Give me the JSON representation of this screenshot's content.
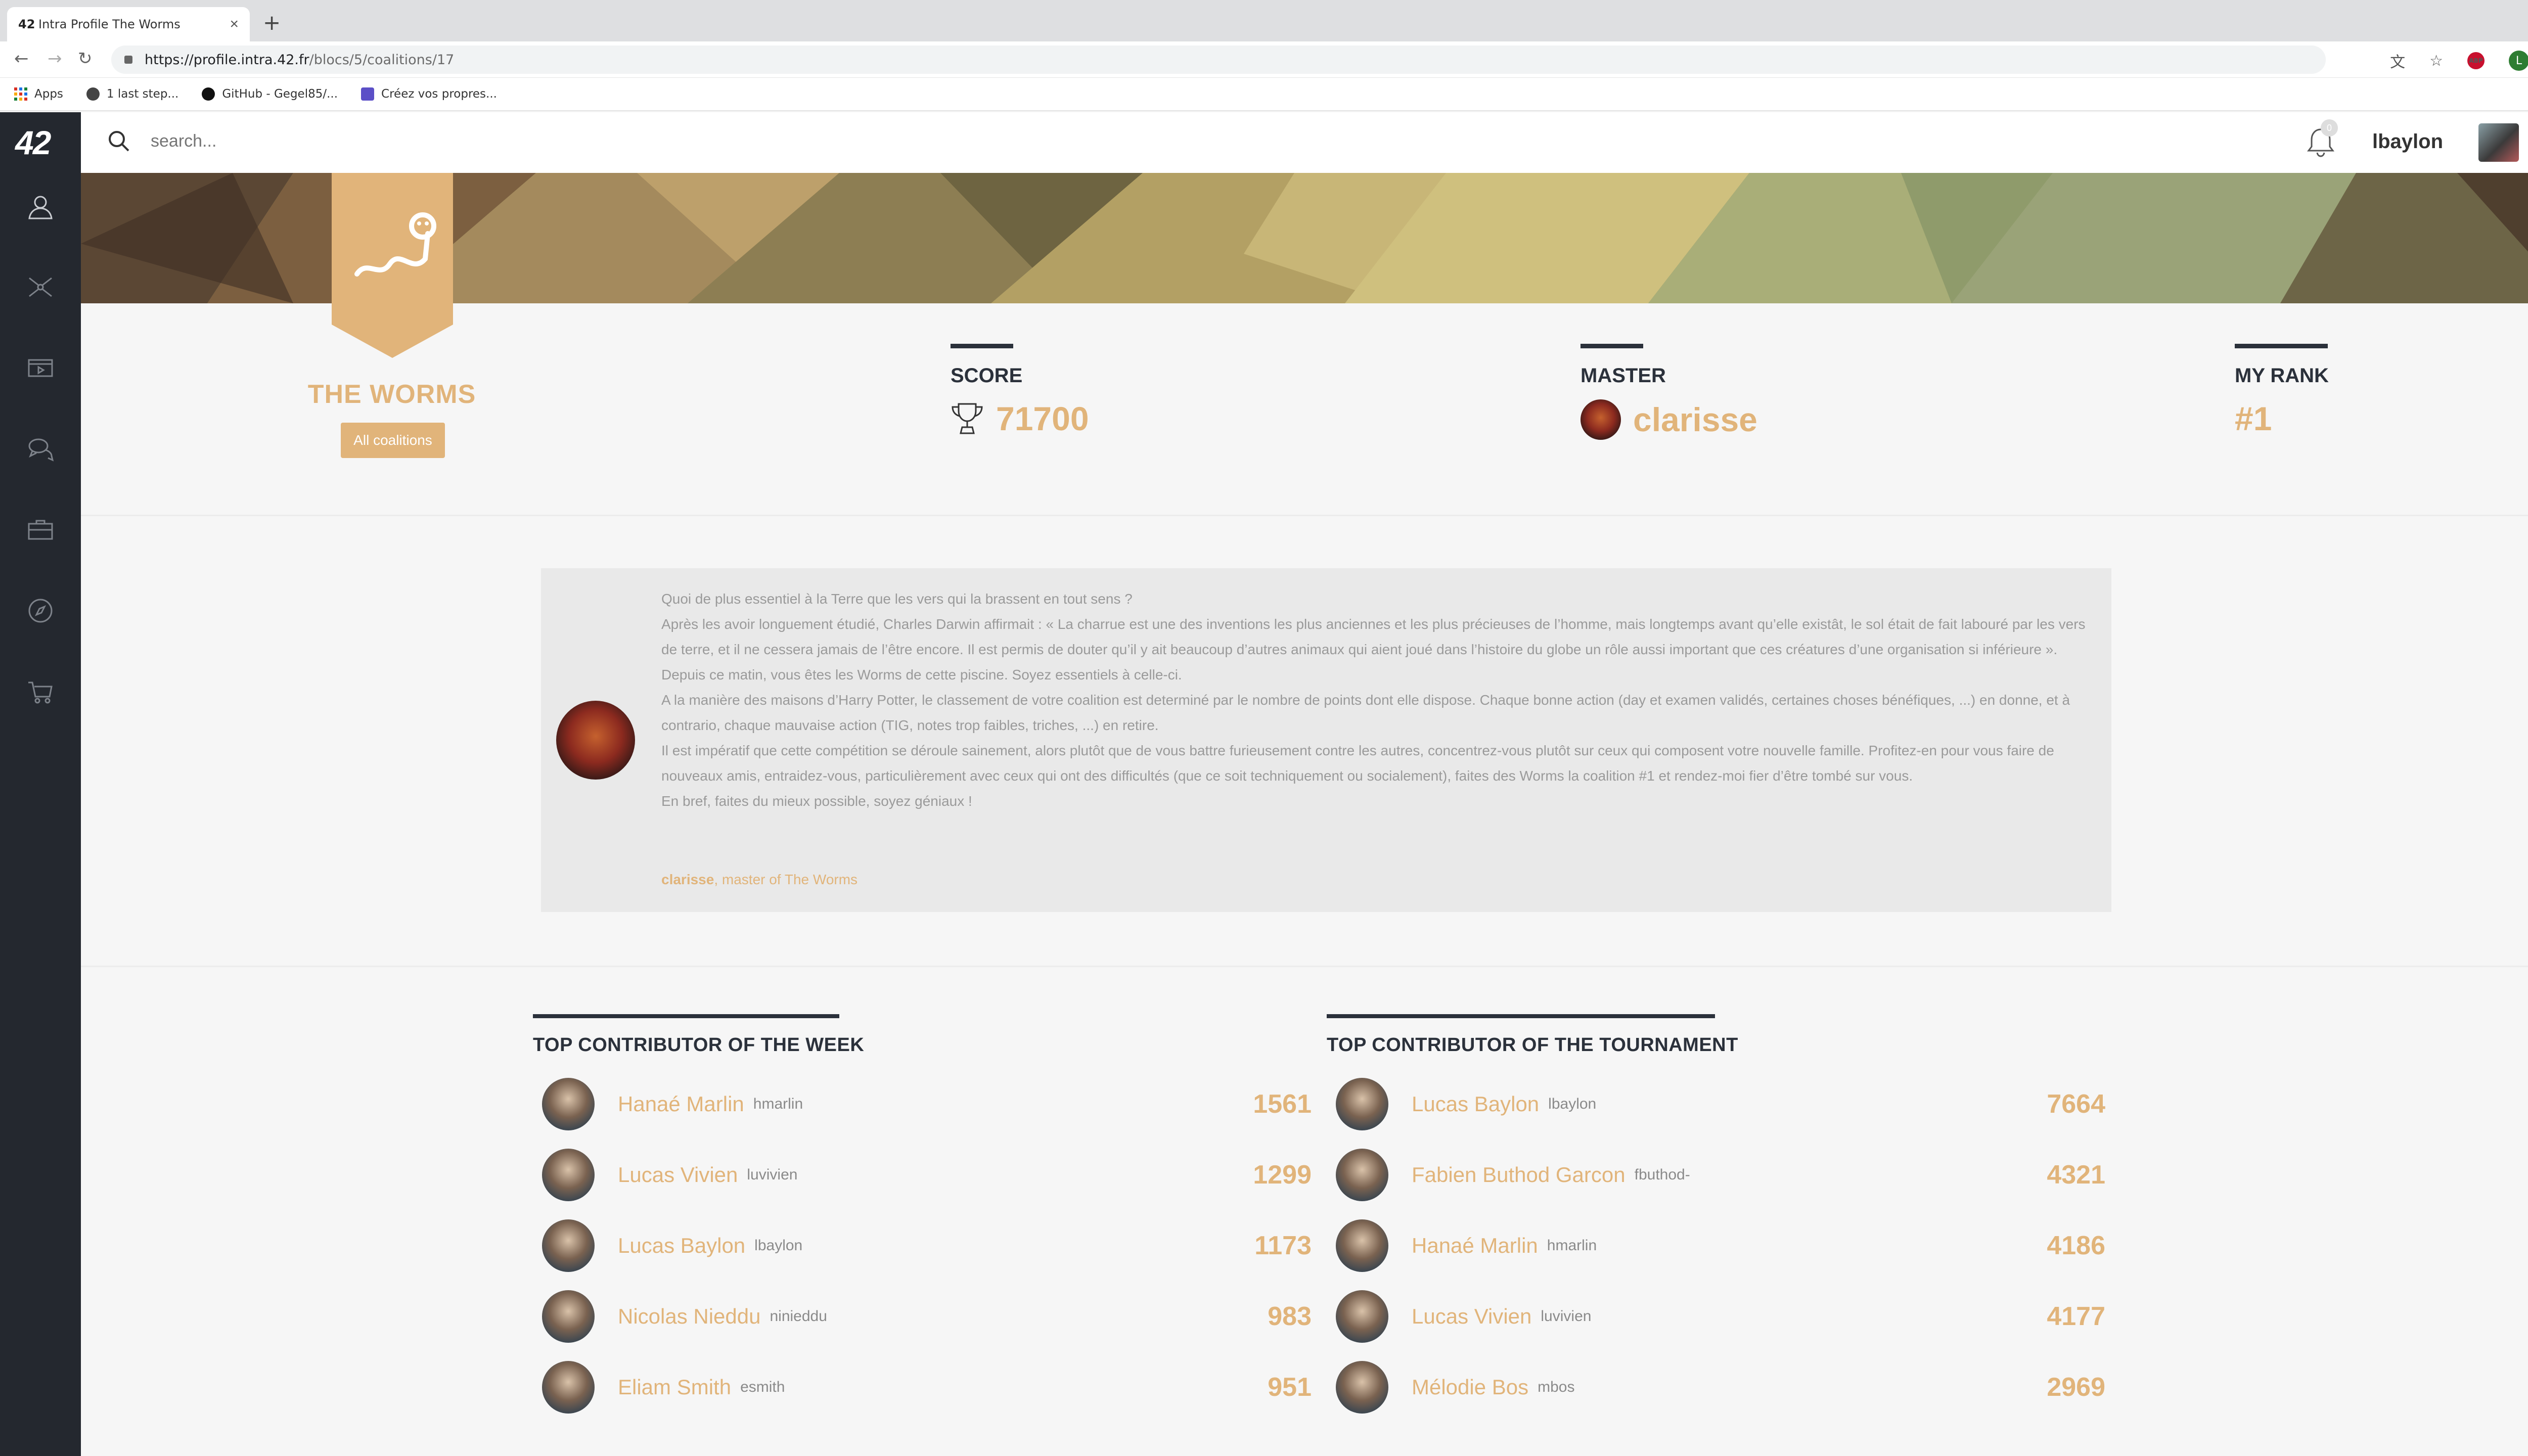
{
  "browser": {
    "tab_title": "Intra Profile The Worms",
    "tab_favicon": "42",
    "url_host": "https://profile.intra.42.fr",
    "url_path": "/blocs/5/coalitions/17",
    "profile_initial": "L",
    "adblock_label": "ABP",
    "bookmarks": [
      {
        "label": "Apps",
        "icon": "apps-grid-icon"
      },
      {
        "label": "1 last step...",
        "icon": "globe-icon"
      },
      {
        "label": "GitHub - Gegel85/...",
        "icon": "github-icon"
      },
      {
        "label": "Créez vos propres...",
        "icon": "bookmark-page-icon"
      }
    ]
  },
  "app": {
    "logo": "42",
    "search_placeholder": "search...",
    "notifications_count": "0",
    "username": "lbaylon",
    "sidebar_icons": [
      "profile-icon",
      "network-icon",
      "projects-icon",
      "chat-icon",
      "briefcase-icon",
      "compass-icon",
      "shop-icon"
    ]
  },
  "coalition": {
    "name": "THE WORMS",
    "all_button": "All coalitions",
    "accent_color": "#e1b47a",
    "score_label": "SCORE",
    "score": "71700",
    "master_label": "MASTER",
    "master": "clarisse",
    "rank_label": "MY RANK",
    "rank": "#1"
  },
  "description": {
    "lines": [
      "Quoi de plus essentiel à la Terre que les vers qui la brassent en tout sens ?",
      "Après les avoir longuement étudié, Charles Darwin affirmait : « La charrue est une des inventions les plus anciennes et les plus précieuses de l’homme, mais longtemps avant qu’elle existât, le sol était de fait labouré par les vers de terre, et il ne cessera jamais de l’être encore. Il est permis de douter qu’il y ait beaucoup d’autres animaux qui aient joué dans l’histoire du globe un rôle aussi important que ces créatures d’une organisation si inférieure ».",
      "Depuis ce matin, vous êtes les Worms de cette piscine. Soyez essentiels à celle-ci.",
      "A la manière des maisons d’Harry Potter, le classement de votre coalition est determiné par le nombre de points dont elle dispose. Chaque bonne action (day et examen validés, certaines choses bénéfiques, ...) en donne, et à contrario, chaque mauvaise action (TIG, notes trop faibles, triches, ...) en retire.",
      "Il est impératif que cette compétition se déroule sainement, alors plutôt que de vous battre furieusement contre les autres, concentrez-vous plutôt sur ceux qui composent votre nouvelle famille. Profitez-en pour vous faire de nouveaux amis, entraidez-vous, particulièrement avec ceux qui ont des difficultés (que ce soit techniquement ou socialement), faites des Worms la coalition #1 et rendez-moi fier d’être tombé sur vous.",
      "En bref, faites du mieux possible, soyez géniaux !"
    ],
    "signature_name": "clarisse",
    "signature_rest": ", master of The Worms"
  },
  "week": {
    "title": "TOP CONTRIBUTOR OF THE WEEK",
    "rows": [
      {
        "name": "Hanaé Marlin",
        "login": "hmarlin",
        "score": "1561"
      },
      {
        "name": "Lucas Vivien",
        "login": "luvivien",
        "score": "1299"
      },
      {
        "name": "Lucas Baylon",
        "login": "lbaylon",
        "score": "1173"
      },
      {
        "name": "Nicolas Nieddu",
        "login": "ninieddu",
        "score": "983"
      },
      {
        "name": "Eliam Smith",
        "login": "esmith",
        "score": "951"
      }
    ]
  },
  "tournament": {
    "title": "TOP CONTRIBUTOR OF THE TOURNAMENT",
    "rows": [
      {
        "name": "Lucas Baylon",
        "login": "lbaylon",
        "score": "7664"
      },
      {
        "name": "Fabien Buthod Garcon",
        "login": "fbuthod-",
        "score": "4321"
      },
      {
        "name": "Hanaé Marlin",
        "login": "hmarlin",
        "score": "4186"
      },
      {
        "name": "Lucas Vivien",
        "login": "luvivien",
        "score": "4177"
      },
      {
        "name": "Mélodie Bos",
        "login": "mbos",
        "score": "2969"
      }
    ]
  }
}
